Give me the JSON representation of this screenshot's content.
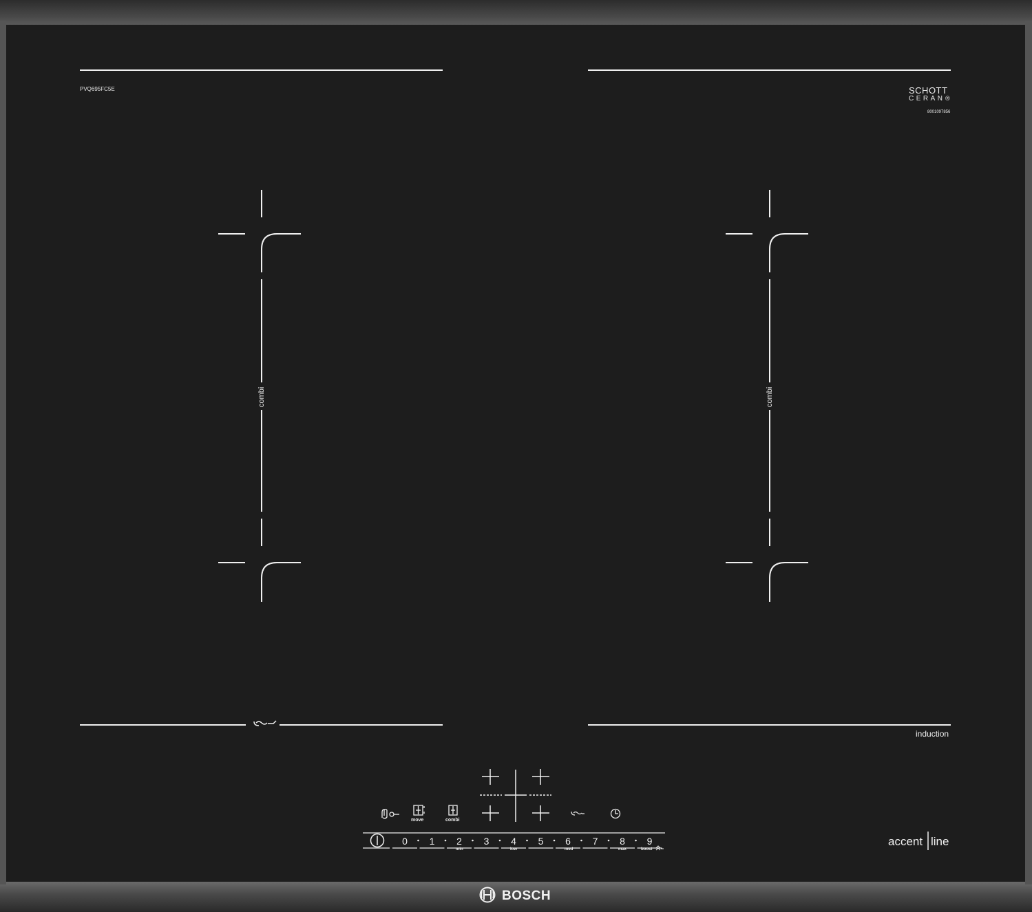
{
  "hob": {
    "model": "PVQ695FC5E",
    "glass_brand_line1": "SCHOTT",
    "glass_brand_line2": "CERAN",
    "glass_brand_reg": "®",
    "glass_serial": "8001097856",
    "zone_label_left": "combi",
    "zone_label_right": "combi",
    "induction_label": "induction",
    "series_part1": "accent",
    "series_part2": "line",
    "brand": "BOSCH"
  },
  "controls": {
    "move_label": "move",
    "combi_label": "combi",
    "power_levels": [
      "0",
      "1",
      "2",
      "3",
      "4",
      "5",
      "6",
      "7",
      "8",
      "9"
    ],
    "level_hints": {
      "min": "min",
      "low": "low",
      "med": "med",
      "max": "max",
      "boost": "boost"
    }
  },
  "colors": {
    "glass": "#1d1d1d",
    "frame": "#3a3a3a",
    "marking": "#f2f2f2"
  }
}
